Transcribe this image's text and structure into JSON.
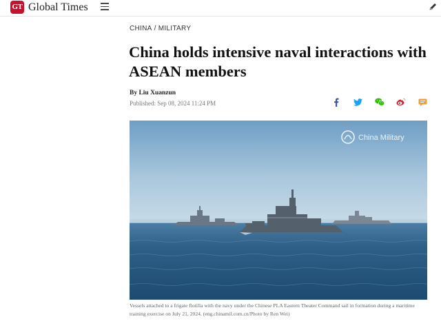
{
  "header": {
    "logo_text": "GT",
    "brand_name": "Global Times",
    "menu_icon": "hamburger-menu-icon",
    "edit_icon": "pen-icon",
    "brand_color": "#c8102e"
  },
  "article": {
    "breadcrumb": {
      "section": "CHINA",
      "separator": "/",
      "subsection": "MILITARY"
    },
    "title": "China holds intensive naval interactions with ASEAN members",
    "author": "By Liu Xuanzun",
    "published": "Published: Sep 08, 2024 11:24 PM",
    "share": [
      {
        "name": "facebook-icon",
        "color": "#3b5998"
      },
      {
        "name": "twitter-icon",
        "color": "#1da1f2"
      },
      {
        "name": "wechat-icon",
        "color": "#2dc100"
      },
      {
        "name": "weibo-icon",
        "color": "#e6162d"
      },
      {
        "name": "comment-icon",
        "color": "#f0a030"
      }
    ],
    "image": {
      "watermark": "China Military"
    },
    "caption": "Vessels attached to a frigate flotilla with the navy under the Chinese PLA Eastern Theater Command sail in formation during a maritime training exercise on July 21, 2024. (eng.chinamil.com.cn/Photo by Ren Wei)"
  }
}
